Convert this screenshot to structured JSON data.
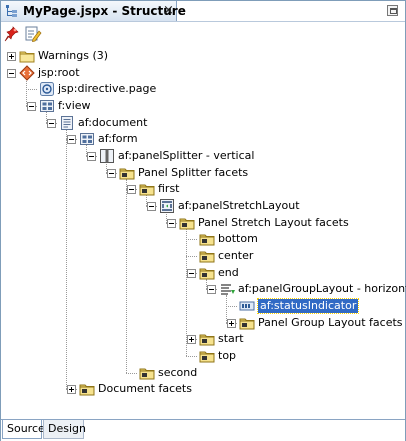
{
  "window": {
    "tab_title": "MyPage.jspx - Structure",
    "close_glyph": "×"
  },
  "toolbar": {
    "freeze_icon": "pushpin-icon",
    "edit_icon": "edit-document-icon"
  },
  "tree": [
    {
      "label": "Warnings (3)",
      "icon": "folder-icon",
      "depth": 0,
      "expander": "plus"
    },
    {
      "label": "jsp:root",
      "icon": "jsp-root-icon",
      "depth": 0,
      "expander": "minus"
    },
    {
      "label": "jsp:directive.page",
      "icon": "jsp-directive-icon",
      "depth": 1,
      "expander": "none"
    },
    {
      "label": "f:view",
      "icon": "component-icon",
      "depth": 1,
      "expander": "minus"
    },
    {
      "label": "af:document",
      "icon": "document-icon",
      "depth": 2,
      "expander": "minus"
    },
    {
      "label": "af:form",
      "icon": "component-icon",
      "depth": 3,
      "expander": "minus"
    },
    {
      "label": "af:panelSplitter - vertical",
      "icon": "panel-splitter-icon",
      "depth": 4,
      "expander": "minus"
    },
    {
      "label": "Panel Splitter facets",
      "icon": "facet-folder-icon",
      "depth": 5,
      "expander": "minus"
    },
    {
      "label": "first",
      "icon": "facet-folder-icon",
      "depth": 6,
      "expander": "minus"
    },
    {
      "label": "af:panelStretchLayout",
      "icon": "panel-stretch-icon",
      "depth": 7,
      "expander": "minus"
    },
    {
      "label": "Panel Stretch Layout facets",
      "icon": "facet-folder-icon",
      "depth": 8,
      "expander": "minus"
    },
    {
      "label": "bottom",
      "icon": "facet-folder-icon",
      "depth": 9,
      "expander": "none"
    },
    {
      "label": "center",
      "icon": "facet-folder-icon",
      "depth": 9,
      "expander": "none"
    },
    {
      "label": "end",
      "icon": "facet-folder-icon",
      "depth": 9,
      "expander": "minus"
    },
    {
      "label": "af:panelGroupLayout - horizontal",
      "icon": "panel-group-icon",
      "depth": 10,
      "expander": "minus"
    },
    {
      "label": "af:statusIndicator",
      "icon": "status-indicator-icon",
      "depth": 11,
      "expander": "none",
      "selected": true
    },
    {
      "label": "Panel Group Layout facets",
      "icon": "facet-folder-icon",
      "depth": 11,
      "expander": "plus"
    },
    {
      "label": "start",
      "icon": "facet-folder-icon",
      "depth": 9,
      "expander": "plus"
    },
    {
      "label": "top",
      "icon": "facet-folder-icon",
      "depth": 9,
      "expander": "none"
    },
    {
      "label": "second",
      "icon": "facet-folder-icon",
      "depth": 6,
      "expander": "none"
    },
    {
      "label": "Document facets",
      "icon": "facet-folder-icon",
      "depth": 3,
      "expander": "plus"
    }
  ],
  "bottom_tabs": [
    {
      "label": "Source",
      "active": true
    },
    {
      "label": "Design",
      "active": false
    }
  ]
}
